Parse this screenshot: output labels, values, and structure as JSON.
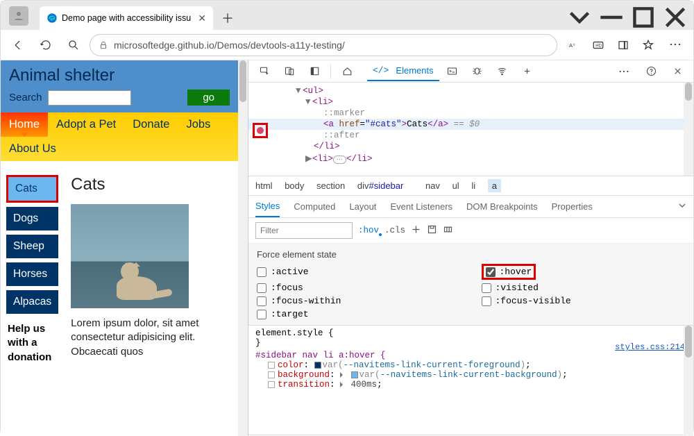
{
  "browser": {
    "tab_title": "Demo page with accessibility issu",
    "url": "microsoftedge.github.io/Demos/devtools-a11y-testing/"
  },
  "page": {
    "title": "Animal shelter",
    "search_label": "Search",
    "go_label": "go",
    "nav": [
      "Home",
      "Adopt a Pet",
      "Donate",
      "Jobs",
      "About Us"
    ],
    "sidebar": [
      "Cats",
      "Dogs",
      "Sheep",
      "Horses",
      "Alpacas"
    ],
    "heading": "Cats",
    "lorem": "Lorem ipsum dolor, sit amet consectetur adipisicing elit. Obcaecati quos",
    "help": "Help us with a donation"
  },
  "devtools": {
    "panel": "Elements",
    "dom": {
      "ul": "<ul>",
      "li_open": "<li>",
      "marker": "::marker",
      "a_open": "<a ",
      "href_attr": "href",
      "href_val": "\"#cats\"",
      "a_text": "Cats",
      "a_close": "</a>",
      "eq": " == $0",
      "after": "::after",
      "li_close": "</li>",
      "li2": "<li>",
      "ellipsis": "…",
      "li2_close": "</li>"
    },
    "crumbs": [
      "html",
      "body",
      "section",
      "div#sidebar",
      "nav",
      "ul",
      "li",
      "a"
    ],
    "styles_tabs": [
      "Styles",
      "Computed",
      "Layout",
      "Event Listeners",
      "DOM Breakpoints",
      "Properties"
    ],
    "filter_placeholder": "Filter",
    "hov": ":hov",
    "cls": ".cls",
    "force_title": "Force element state",
    "states": {
      "active": ":active",
      "hover": ":hover",
      "focus": ":focus",
      "visited": ":visited",
      "focus_within": ":focus-within",
      "focus_visible": ":focus-visible",
      "target": ":target"
    },
    "rules": {
      "element_style": "element.style {",
      "close": "}",
      "selector": "#sidebar nav li a:hover {",
      "color_prop": "color",
      "color_val": "var(--navitems-link-current-foreground)",
      "bg_prop": "background",
      "bg_val": "var(--navitems-link-current-background)",
      "trans_prop": "transition",
      "trans_val": "400ms",
      "link": "styles.css:214"
    }
  }
}
